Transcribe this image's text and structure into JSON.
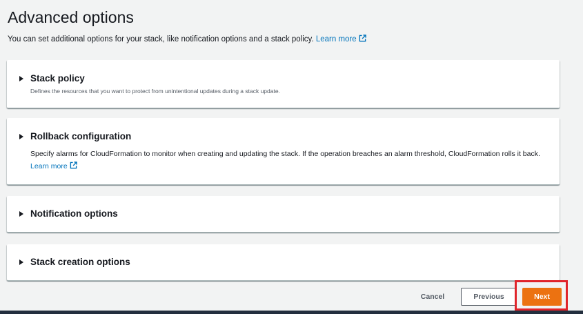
{
  "page": {
    "title": "Advanced options",
    "description": "You can set additional options for your stack, like notification options and a stack policy.",
    "learn_more": "Learn more"
  },
  "panels": [
    {
      "title": "Stack policy",
      "description": "Defines the resources that you want to protect from unintentional updates during a stack update."
    },
    {
      "title": "Rollback configuration",
      "description": "Specify alarms for CloudFormation to monitor when creating and updating the stack. If the operation breaches an alarm threshold, CloudFormation rolls it back.",
      "learn_more": "Learn more"
    },
    {
      "title": "Notification options"
    },
    {
      "title": "Stack creation options"
    }
  ],
  "footer": {
    "cancel_label": "Cancel",
    "previous_label": "Previous",
    "next_label": "Next"
  },
  "colors": {
    "accent": "#ec7211",
    "link": "#0073bb",
    "highlight": "#e0242b"
  }
}
